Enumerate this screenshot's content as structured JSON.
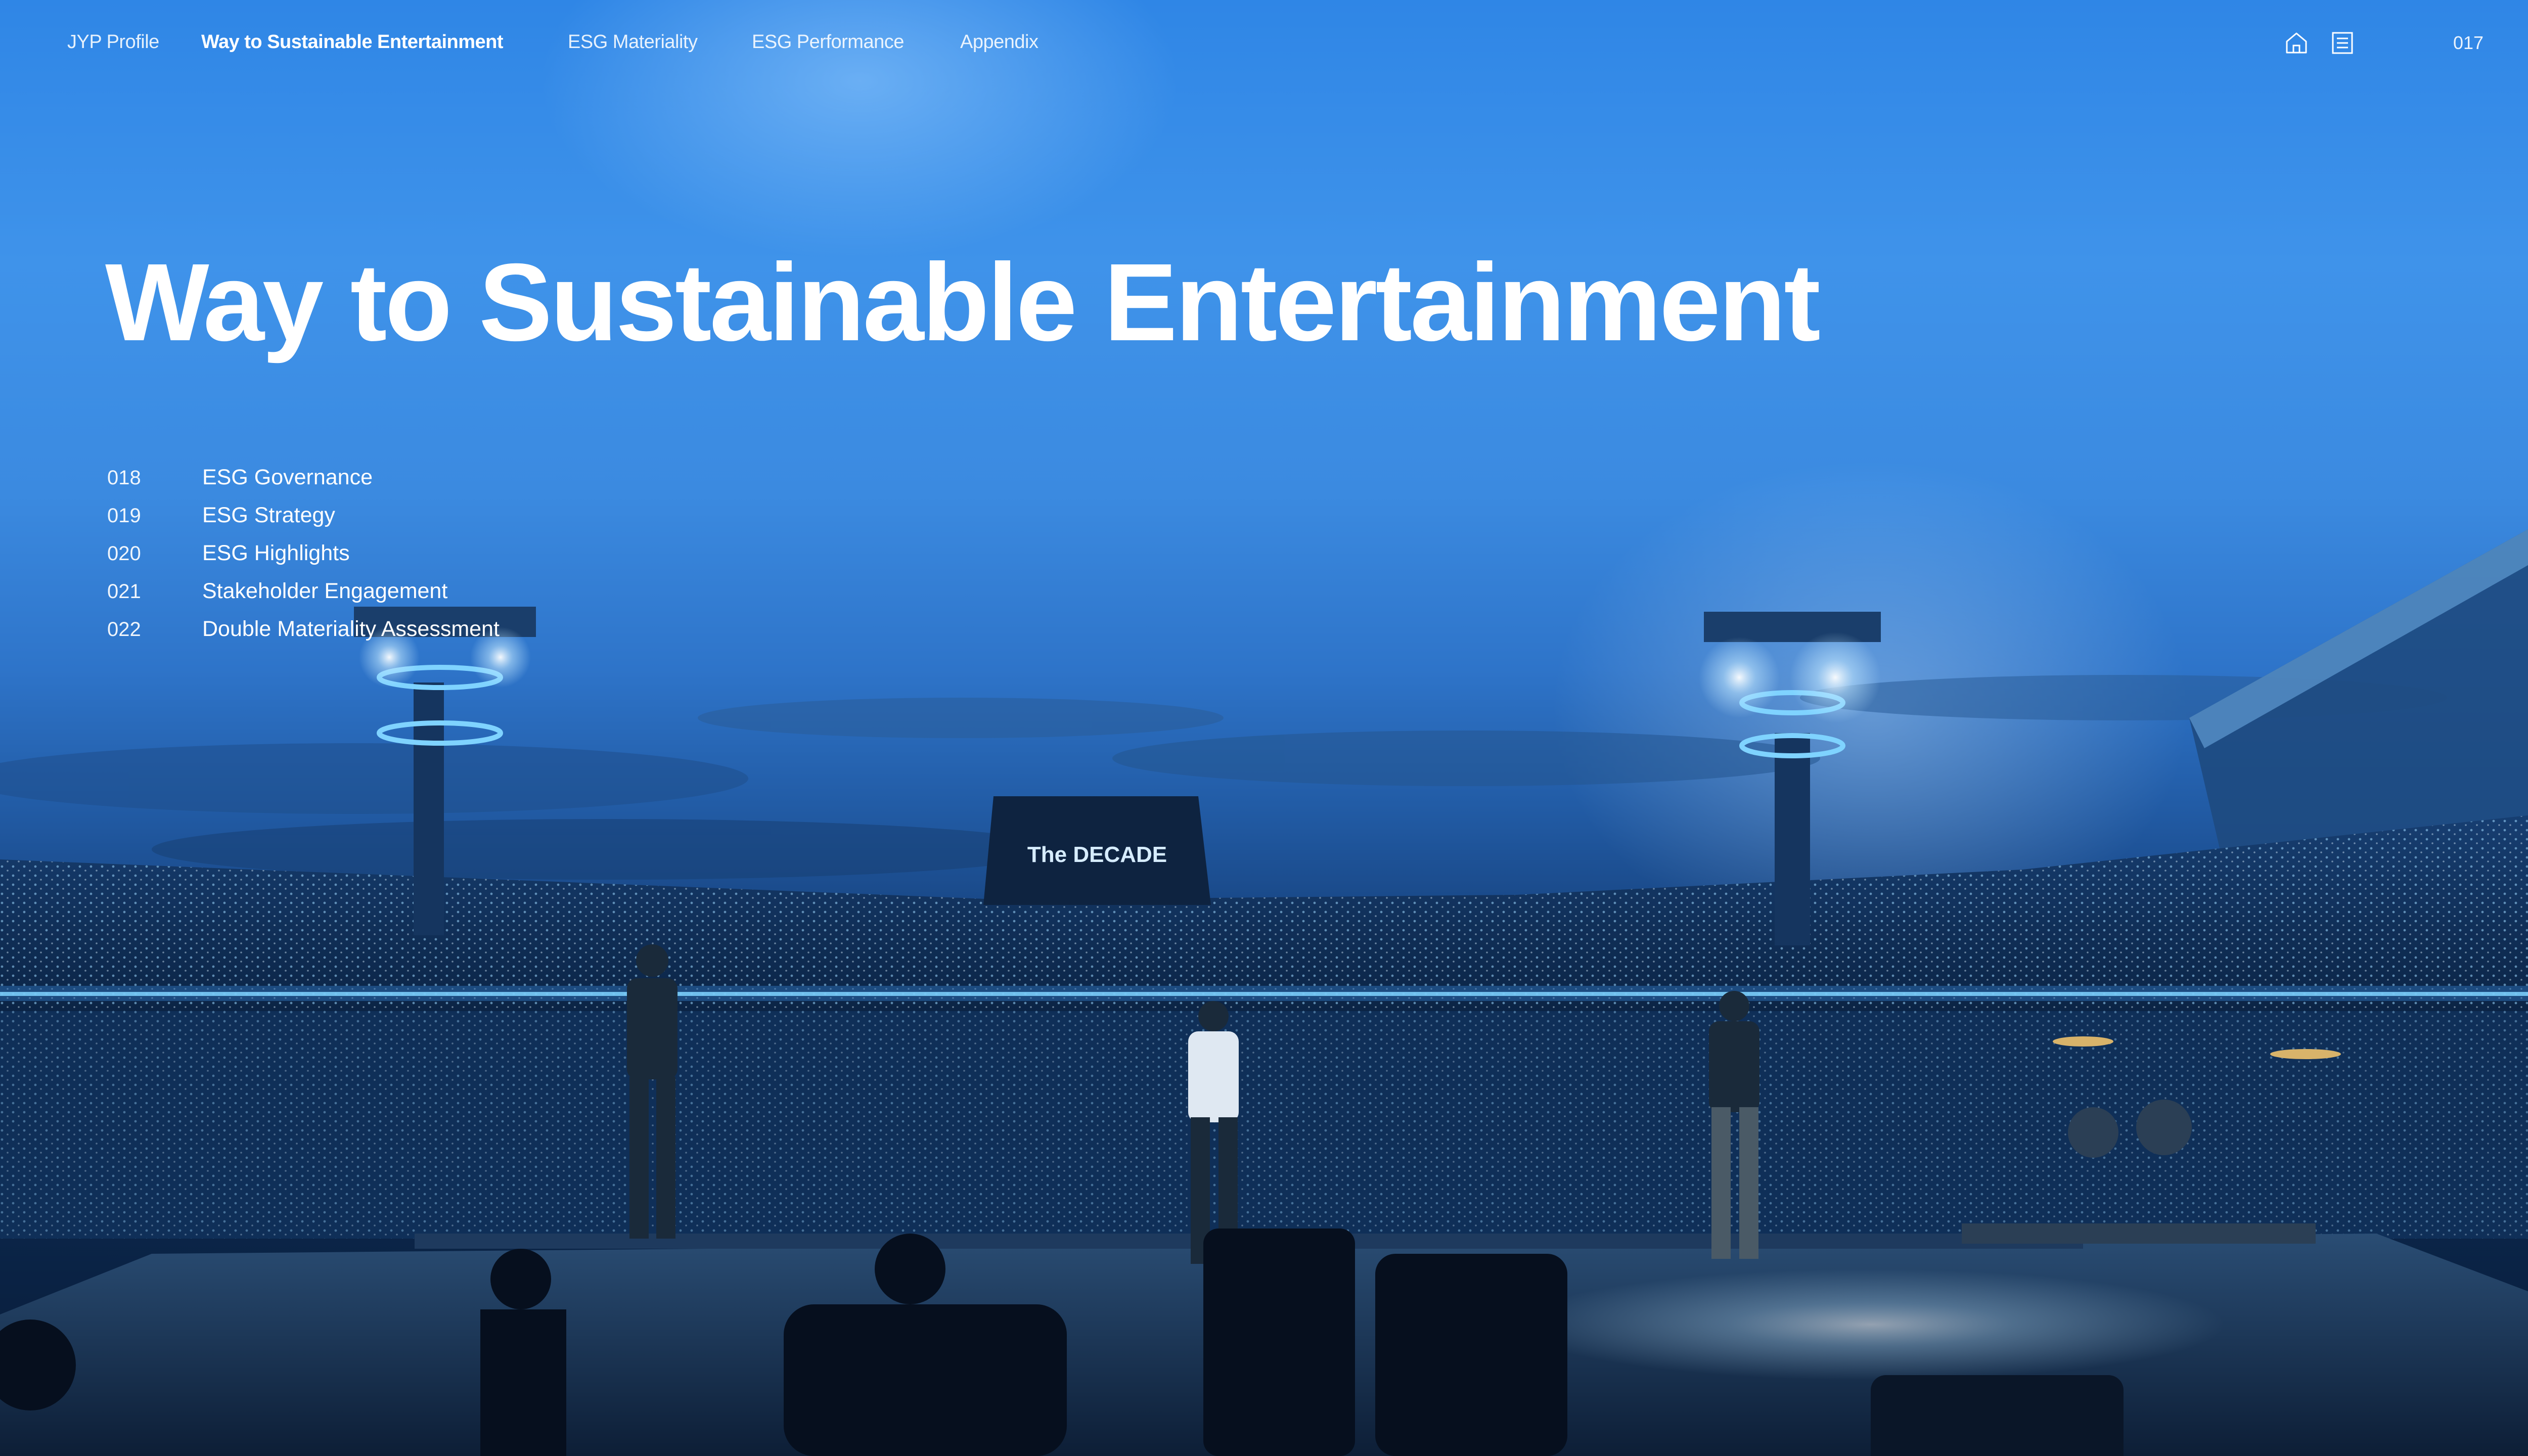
{
  "nav": {
    "items": [
      {
        "label": "JYP Profile"
      },
      {
        "label": "Way to Sustainable Entertainment"
      },
      {
        "label": "ESG Materiality"
      },
      {
        "label": "ESG Performance"
      },
      {
        "label": "Appendix"
      }
    ],
    "icons": [
      "home-icon",
      "list-icon"
    ],
    "page_number": "017"
  },
  "title": "Way to Sustainable Entertainment",
  "toc": [
    {
      "page": "018",
      "label": "ESG Governance"
    },
    {
      "page": "019",
      "label": "ESG Strategy"
    },
    {
      "page": "020",
      "label": "ESG Highlights"
    },
    {
      "page": "021",
      "label": "Stakeholder Engagement"
    },
    {
      "page": "022",
      "label": "Double Materiality Assessment"
    }
  ],
  "photo": {
    "screen_text": "The DECADE"
  },
  "colors": {
    "sky_top": "#2f86e6",
    "ground": "#081a35",
    "accent_light": "#7fd3ff"
  }
}
